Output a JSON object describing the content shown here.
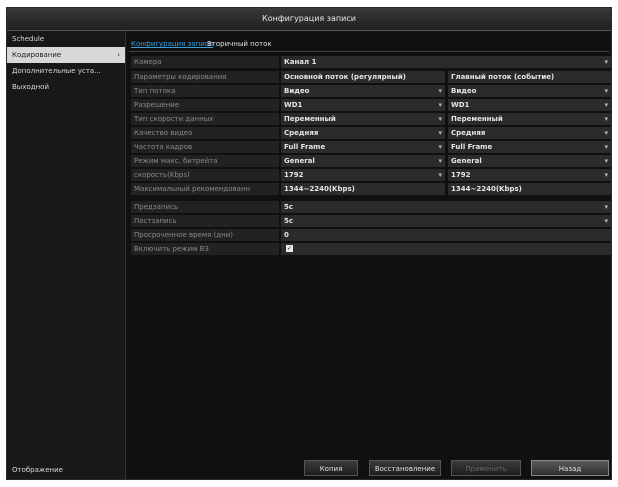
{
  "window": {
    "title": "Конфигурация записи"
  },
  "sidebar": {
    "items": [
      {
        "label": "Schedule",
        "active": false
      },
      {
        "label": "Кодирование",
        "active": true,
        "arrow": "›"
      },
      {
        "label": "Дополнительные уста...",
        "active": false
      },
      {
        "label": "Выходной",
        "active": false
      }
    ],
    "footer": "Отображение"
  },
  "tabs": [
    "Конфигурация записи",
    "Вторичный поток"
  ],
  "form": {
    "camera": {
      "label": "Камера",
      "value": "Канал 1"
    },
    "params": {
      "label": "Параметры кодирования",
      "v1": "Основной поток (регулярный)",
      "v2": "Главный поток (событие)"
    },
    "stream_type": {
      "label": "Тип потока",
      "v1": "Видео",
      "v2": "Видео"
    },
    "resolution": {
      "label": "Разрешение",
      "v1": "WD1",
      "v2": "WD1"
    },
    "bitrate_type": {
      "label": "Тип скорости данных",
      "v1": "Переменный",
      "v2": "Переменный"
    },
    "video_quality": {
      "label": "Качество видео",
      "v1": "Средняя",
      "v2": "Средняя"
    },
    "frame_rate": {
      "label": "Частота кадров",
      "v1": "Full Frame",
      "v2": "Full Frame"
    },
    "bitrate_mode": {
      "label": "Режим макс. битрейта",
      "v1": "General",
      "v2": "General"
    },
    "max_bitrate": {
      "label": "скорость(Kbps)",
      "v1": "1792",
      "v2": "1792"
    },
    "max_recommended": {
      "label": "Максимальный рекомендованн",
      "v1": "1344~2240(Kbps)",
      "v2": "1344~2240(Kbps)"
    },
    "pre_record": {
      "label": "Предзапись",
      "value": "5с"
    },
    "post_record": {
      "label": "Постзапись",
      "value": "5с"
    },
    "expire_time": {
      "label": "Просроченное время (дни)",
      "value": "0"
    },
    "redundant": {
      "label": "Включить режим ВЗ",
      "checked": true
    }
  },
  "buttons": {
    "copy": "Копия",
    "restore": "Восстановление",
    "apply": "Применить",
    "back": "Назад"
  },
  "icons": {
    "dropdown": "caret-down-icon",
    "check": "check-icon"
  }
}
